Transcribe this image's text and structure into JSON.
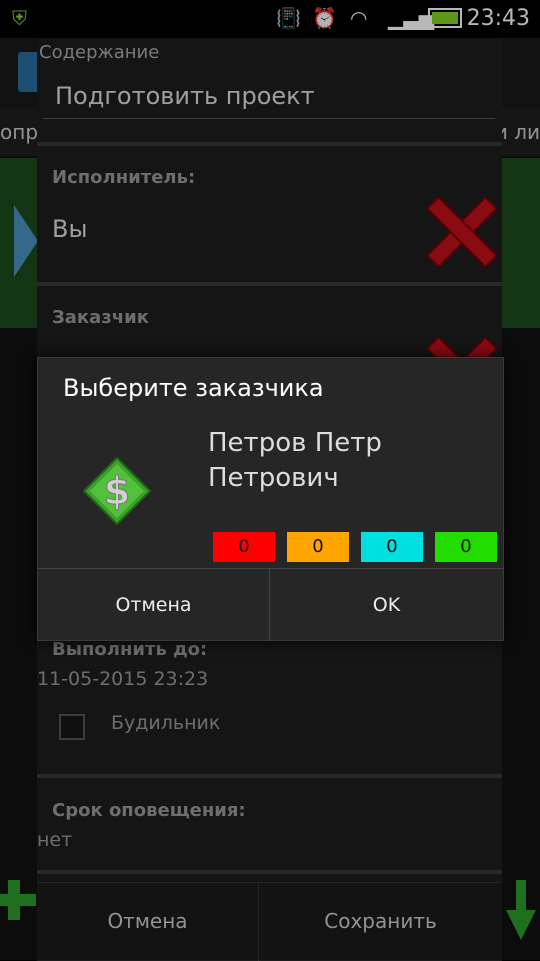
{
  "status_bar": {
    "time": "23:43",
    "icons": [
      "shield-app-icon",
      "vibrate-icon",
      "alarm-icon",
      "wifi-icon",
      "signal-icon",
      "battery-icon"
    ]
  },
  "background": {
    "tab_left": "опр",
    "tab_right": "и ли"
  },
  "form": {
    "content_label": "Содержание",
    "content_value": "Подготовить проект",
    "executor_label": "Исполнитель:",
    "executor_value": "Вы",
    "customer_label": "Заказчик",
    "deadline_label": "Выполнить до:",
    "deadline_value": "11-05-2015 23:23",
    "alarm_label": "Будильник",
    "notify_label": "Срок оповещения:",
    "notify_value": "нет",
    "cancel_label": "Отмена",
    "save_label": "Сохранить"
  },
  "dialog": {
    "title": "Выберите заказчика",
    "customer_name_line1": "Петров Петр",
    "customer_name_line2": "Петрович",
    "counters": [
      {
        "value": "0",
        "color": "#ff0000"
      },
      {
        "value": "0",
        "color": "#ffa500"
      },
      {
        "value": "0",
        "color": "#00e0e0"
      },
      {
        "value": "0",
        "color": "#22dd00"
      }
    ],
    "cancel_label": "Отмена",
    "ok_label": "OK"
  }
}
